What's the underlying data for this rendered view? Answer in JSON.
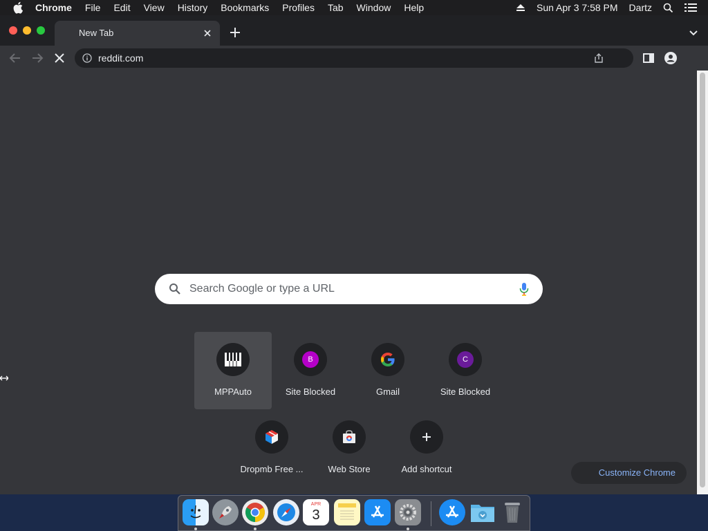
{
  "menubar": {
    "app_name": "Chrome",
    "items": [
      "File",
      "Edit",
      "View",
      "History",
      "Bookmarks",
      "Profiles",
      "Tab",
      "Window",
      "Help"
    ],
    "datetime": "Sun Apr 3  7:58 PM",
    "user": "Dartz"
  },
  "tab": {
    "title": "New Tab"
  },
  "omnibox": {
    "url": "reddit.com"
  },
  "search": {
    "placeholder": "Search Google or type a URL"
  },
  "shortcuts": [
    {
      "label": "MPPAuto",
      "icon": "piano-icon"
    },
    {
      "label": "Site Blocked",
      "icon": "letter-b-icon",
      "letter": "B",
      "color": "#b400c8"
    },
    {
      "label": "Gmail",
      "icon": "google-icon"
    },
    {
      "label": "Site Blocked",
      "icon": "letter-c-icon",
      "letter": "C",
      "color": "#6a1b9a"
    },
    {
      "label": "Dropmb Free ...",
      "icon": "cube-icon"
    },
    {
      "label": "Web Store",
      "icon": "web-store-icon"
    },
    {
      "label": "Add shortcut",
      "icon": "plus-icon"
    }
  ],
  "customize": {
    "label": "Customize Chrome"
  },
  "dock": [
    "finder",
    "launchpad",
    "chrome",
    "safari",
    "calendar",
    "notes",
    "app-store",
    "system-preferences",
    "app-store-downloads",
    "folder",
    "trash"
  ],
  "calendar": {
    "month": "APR",
    "day": "3"
  },
  "colors": {
    "window_bg": "#35363a",
    "tabstrip_bg": "#202124",
    "accent_link": "#8ab4f8"
  }
}
